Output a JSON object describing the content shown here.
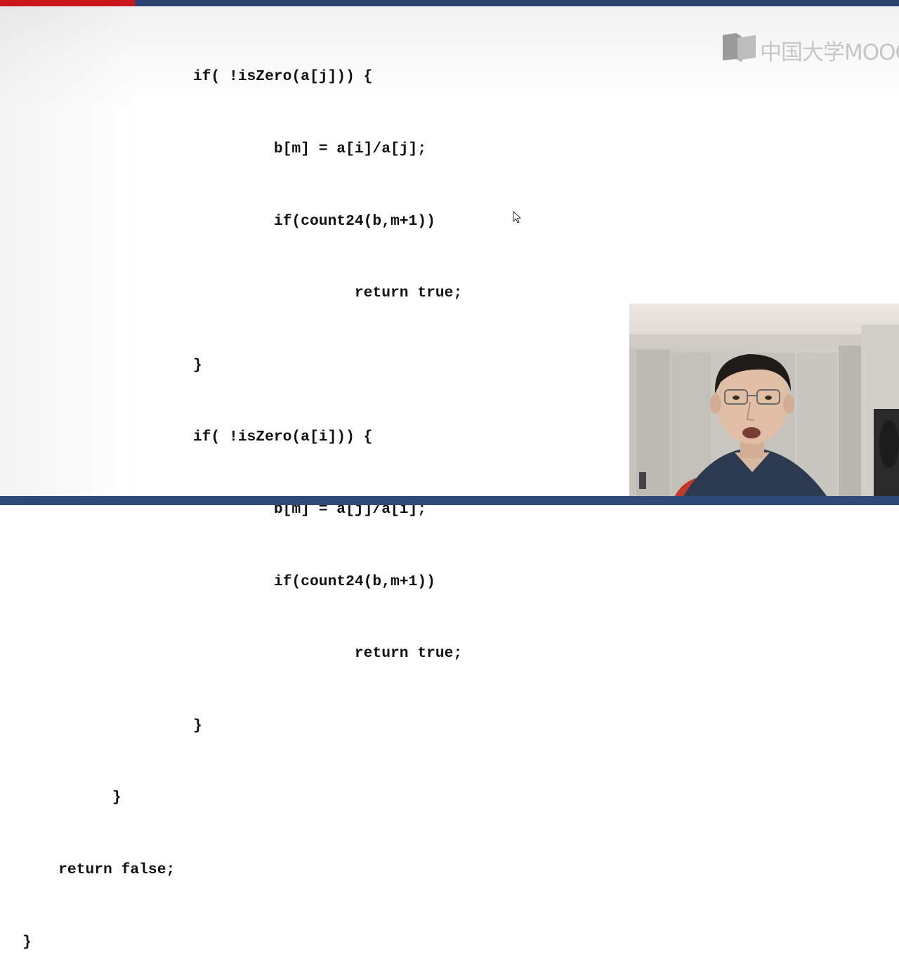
{
  "slide": {
    "code_lines": [
      "                   if( !isZero(a[j])) {",
      "                            b[m] = a[i]/a[j];",
      "                            if(count24(b,m+1))",
      "                                     return true;",
      "                   }",
      "                   if( !isZero(a[i])) {",
      "                            b[m] = a[j]/a[i];",
      "                            if(count24(b,m+1))",
      "                                     return true;",
      "                   }",
      "          }",
      "    return false;",
      "}"
    ]
  },
  "logo": {
    "text": "中国大学MOOC",
    "icon": "mooc-logo-icon"
  },
  "webcam": {
    "icon": "presenter-video-feed"
  },
  "colors": {
    "top_bar_red": "#c8161d",
    "top_bar_blue": "#2c4370",
    "bottom_bar": "#2f4a78",
    "code_text": "#111111",
    "logo_gray": "#c6c6c6"
  }
}
